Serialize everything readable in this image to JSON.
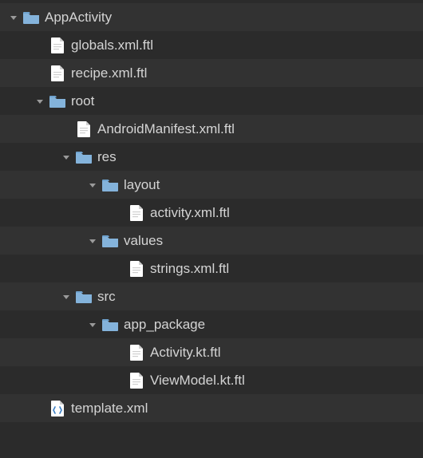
{
  "tree": {
    "items": [
      {
        "label": "AppActivity",
        "type": "folder",
        "depth": 0,
        "expanded": true
      },
      {
        "label": "globals.xml.ftl",
        "type": "file",
        "iconKind": "text",
        "depth": 1
      },
      {
        "label": "recipe.xml.ftl",
        "type": "file",
        "iconKind": "text",
        "depth": 1
      },
      {
        "label": "root",
        "type": "folder",
        "depth": 1,
        "expanded": true
      },
      {
        "label": "AndroidManifest.xml.ftl",
        "type": "file",
        "iconKind": "text",
        "depth": 2
      },
      {
        "label": "res",
        "type": "folder",
        "depth": 2,
        "expanded": true
      },
      {
        "label": "layout",
        "type": "folder",
        "depth": 3,
        "expanded": true
      },
      {
        "label": "activity.xml.ftl",
        "type": "file",
        "iconKind": "text",
        "depth": 4
      },
      {
        "label": "values",
        "type": "folder",
        "depth": 3,
        "expanded": true
      },
      {
        "label": "strings.xml.ftl",
        "type": "file",
        "iconKind": "text",
        "depth": 4
      },
      {
        "label": "src",
        "type": "folder",
        "depth": 2,
        "expanded": true
      },
      {
        "label": "app_package",
        "type": "folder",
        "depth": 3,
        "expanded": true
      },
      {
        "label": "Activity.kt.ftl",
        "type": "file",
        "iconKind": "text",
        "depth": 4
      },
      {
        "label": "ViewModel.kt.ftl",
        "type": "file",
        "iconKind": "text",
        "depth": 4
      },
      {
        "label": "template.xml",
        "type": "file",
        "iconKind": "xml",
        "depth": 1
      }
    ]
  },
  "colors": {
    "folder": "#84b3db",
    "folderTab": "#6fa3cf",
    "disclosure": "#9a9a9a",
    "fileBody": "#ffffff",
    "fileFold": "#d0d0d0",
    "xmlAccent": "#3a7fc4"
  }
}
